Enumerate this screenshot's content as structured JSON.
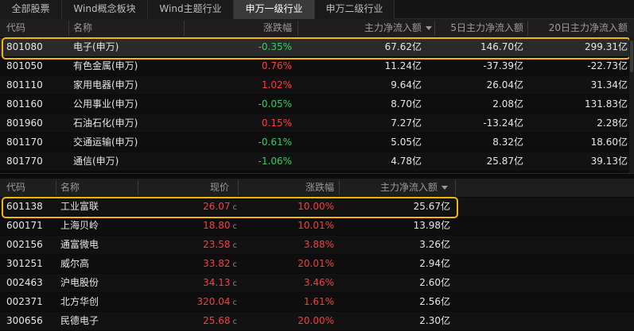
{
  "tabs": [
    "全部股票",
    "Wind概念板块",
    "Wind主题行业",
    "申万一级行业",
    "申万二级行业"
  ],
  "active_tab": "申万一级行业",
  "colors": {
    "up": "#ff3b3b",
    "down": "#2fd15a",
    "highlight": "#f2b705",
    "active_tab": "#3a3a3a"
  },
  "sector_table": {
    "headers": {
      "code": "代码",
      "name": "名称",
      "change": "涨跌幅",
      "main_flow": "主力净流入额",
      "flow_5d": "5日主力净流入额",
      "flow_20d": "20日主力净流入额"
    },
    "rows": [
      {
        "code": "801080",
        "name": "电子(申万)",
        "change": "-0.35%",
        "main_flow": "67.62亿",
        "flow_5d": "146.70亿",
        "flow_20d": "299.31亿"
      },
      {
        "code": "801050",
        "name": "有色金属(申万)",
        "change": "0.76%",
        "main_flow": "11.24亿",
        "flow_5d": "-37.39亿",
        "flow_20d": "-22.73亿"
      },
      {
        "code": "801110",
        "name": "家用电器(申万)",
        "change": "1.02%",
        "main_flow": "9.64亿",
        "flow_5d": "26.04亿",
        "flow_20d": "31.34亿"
      },
      {
        "code": "801160",
        "name": "公用事业(申万)",
        "change": "-0.05%",
        "main_flow": "8.70亿",
        "flow_5d": "2.08亿",
        "flow_20d": "131.83亿"
      },
      {
        "code": "801960",
        "name": "石油石化(申万)",
        "change": "0.15%",
        "main_flow": "7.27亿",
        "flow_5d": "-13.24亿",
        "flow_20d": "2.28亿"
      },
      {
        "code": "801170",
        "name": "交通运输(申万)",
        "change": "-0.61%",
        "main_flow": "5.05亿",
        "flow_5d": "8.32亿",
        "flow_20d": "18.60亿"
      },
      {
        "code": "801770",
        "name": "通信(申万)",
        "change": "-1.06%",
        "main_flow": "4.78亿",
        "flow_5d": "25.87亿",
        "flow_20d": "39.13亿"
      }
    ]
  },
  "stock_table": {
    "headers": {
      "code": "代码",
      "name": "名称",
      "price": "现价",
      "change": "涨跌幅",
      "main_flow": "主力净流入额"
    },
    "price_flag": "c",
    "rows": [
      {
        "code": "601138",
        "name": "工业富联",
        "price": "26.07",
        "change": "10.00%",
        "main_flow": "25.67亿"
      },
      {
        "code": "600171",
        "name": "上海贝岭",
        "price": "18.80",
        "change": "10.01%",
        "main_flow": "13.98亿"
      },
      {
        "code": "002156",
        "name": "通富微电",
        "price": "23.58",
        "change": "3.88%",
        "main_flow": "3.26亿"
      },
      {
        "code": "301251",
        "name": "威尔高",
        "price": "33.82",
        "change": "20.01%",
        "main_flow": "2.94亿"
      },
      {
        "code": "002463",
        "name": "沪电股份",
        "price": "34.13",
        "change": "3.46%",
        "main_flow": "2.60亿"
      },
      {
        "code": "002371",
        "name": "北方华创",
        "price": "320.04",
        "change": "1.61%",
        "main_flow": "2.56亿"
      },
      {
        "code": "300656",
        "name": "民德电子",
        "price": "25.68",
        "change": "20.00%",
        "main_flow": "2.30亿"
      }
    ]
  }
}
